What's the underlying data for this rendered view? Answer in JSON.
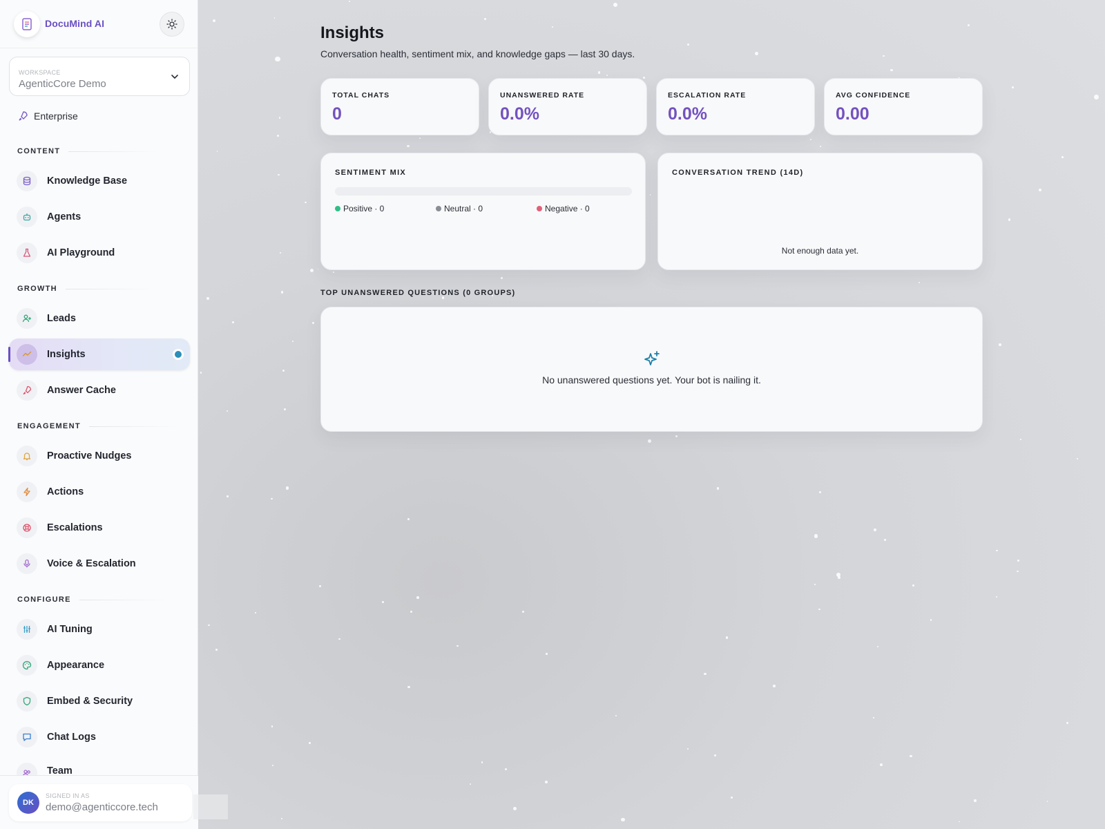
{
  "sidebar": {
    "brand": "DocuMind AI",
    "workspace": {
      "label": "WORKSPACE",
      "value": "AgenticCore Demo"
    },
    "plan": "Enterprise",
    "sections": [
      {
        "title": "CONTENT",
        "items": [
          "Knowledge Base",
          "Agents",
          "AI Playground"
        ]
      },
      {
        "title": "GROWTH",
        "items": [
          "Leads",
          "Insights",
          "Answer Cache"
        ]
      },
      {
        "title": "ENGAGEMENT",
        "items": [
          "Proactive Nudges",
          "Actions",
          "Escalations",
          "Voice & Escalation"
        ]
      },
      {
        "title": "CONFIGURE",
        "items": [
          "AI Tuning",
          "Appearance",
          "Embed & Security",
          "Chat Logs",
          "Team"
        ]
      }
    ],
    "active_item": "Insights",
    "user": {
      "initials": "DK",
      "signed_in_label": "SIGNED IN AS",
      "email": "demo@agenticcore.tech"
    }
  },
  "page": {
    "title": "Insights",
    "subtitle": "Conversation health, sentiment mix, and knowledge gaps — last 30 days."
  },
  "kpis": [
    {
      "label": "TOTAL CHATS",
      "value": "0"
    },
    {
      "label": "UNANSWERED RATE",
      "value": "0.0%"
    },
    {
      "label": "ESCALATION RATE",
      "value": "0.0%"
    },
    {
      "label": "AVG CONFIDENCE",
      "value": "0.00"
    }
  ],
  "sentiment": {
    "title": "SENTIMENT MIX",
    "positive": "Positive · 0",
    "neutral": "Neutral · 0",
    "negative": "Negative · 0",
    "colors": {
      "positive": "#2fbf86",
      "neutral": "#8a8d93",
      "negative": "#e0607a"
    }
  },
  "trend": {
    "title": "CONVERSATION TREND (14D)",
    "empty": "Not enough data yet."
  },
  "unanswered": {
    "title": "TOP UNANSWERED QUESTIONS (0 GROUPS)",
    "empty": "No unanswered questions yet. Your bot is nailing it."
  },
  "colors": {
    "accent": "#7352bf",
    "active_dot": "#2b8fb8"
  }
}
